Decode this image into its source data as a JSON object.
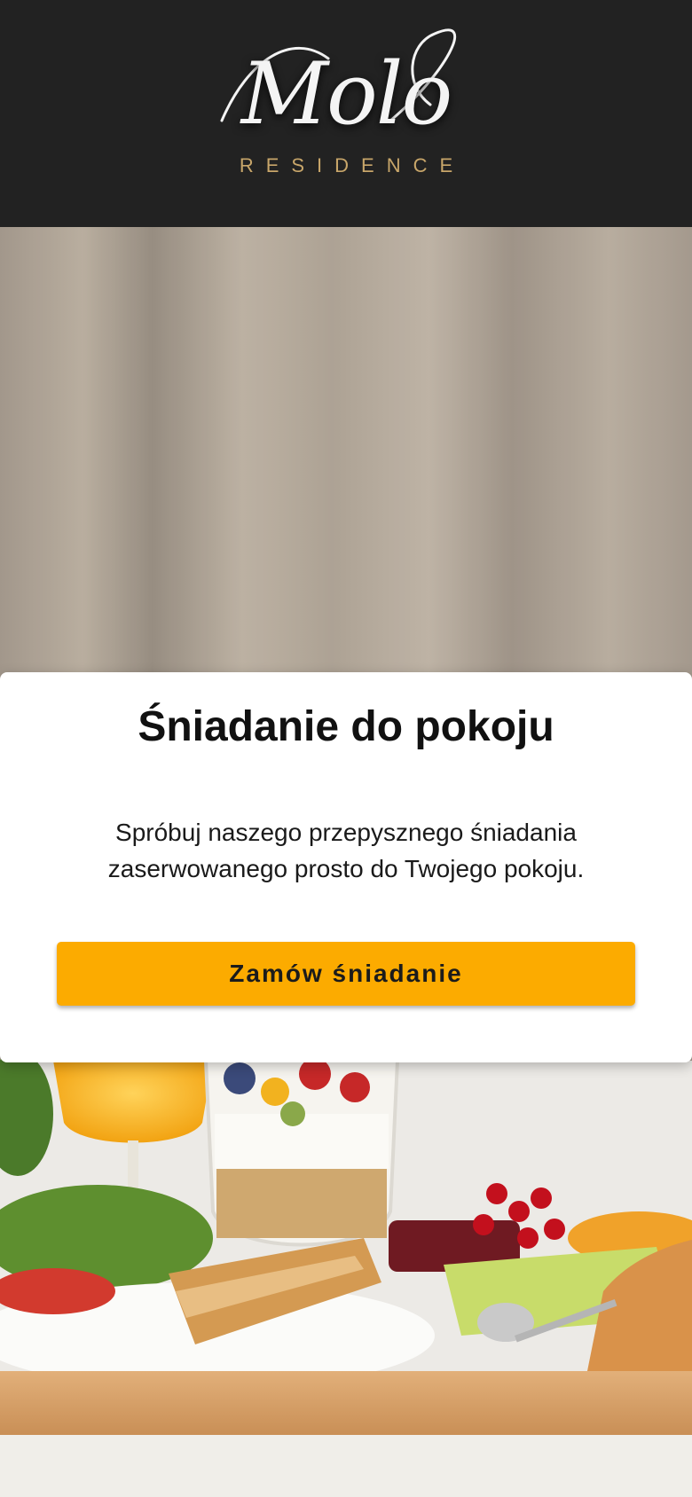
{
  "brand": {
    "logo_script": "Molo",
    "logo_subtitle": "RESIDENCE"
  },
  "promo": {
    "title": "Śniadanie do pokoju",
    "description": "Spróbuj naszego przepysznego śniadania zaserwowanego prosto do Twojego pokoju.",
    "cta_label": "Zamów śniadanie"
  },
  "colors": {
    "header_bg": "#222222",
    "accent": "#fcab00",
    "logo_gold": "#c8a66a",
    "card_bg": "#ffffff"
  }
}
